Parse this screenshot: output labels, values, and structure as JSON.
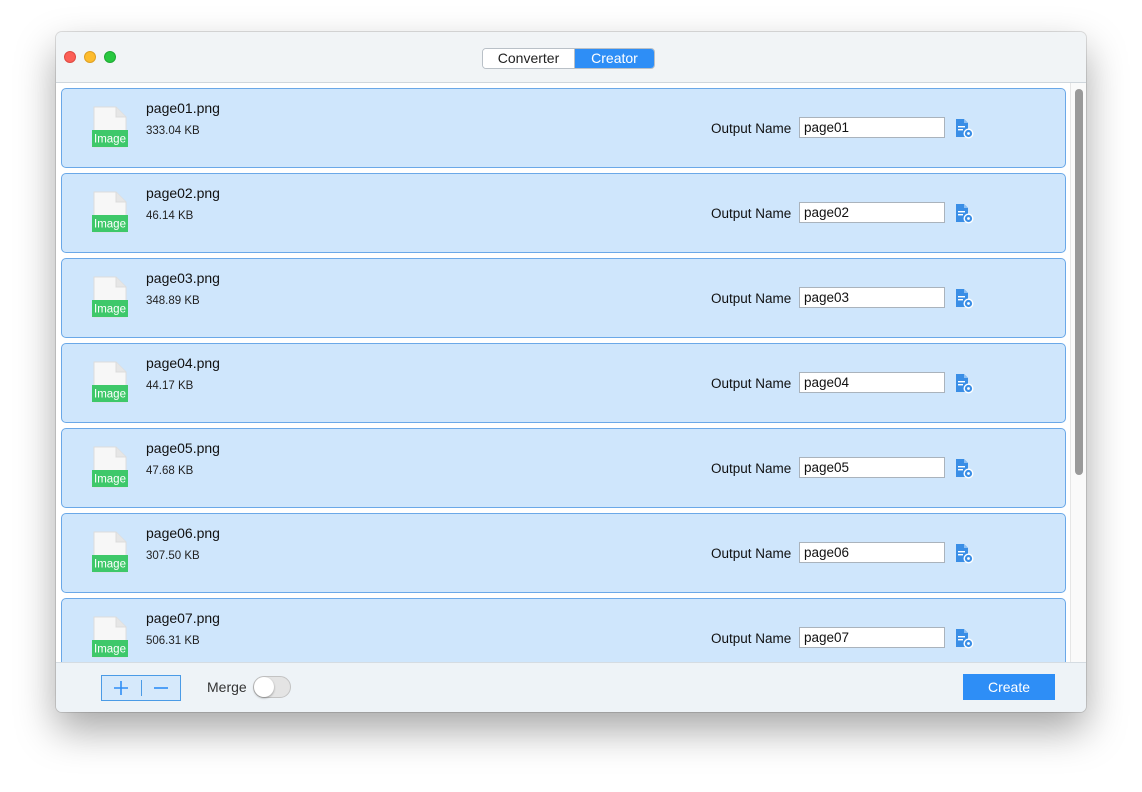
{
  "window": {
    "tabs": [
      {
        "label": "Converter",
        "selected": false
      },
      {
        "label": "Creator",
        "selected": true
      }
    ]
  },
  "files": [
    {
      "type_badge": "Image",
      "name": "page01.png",
      "size": "333.04 KB",
      "output_label": "Output Name",
      "output_name": "page01"
    },
    {
      "type_badge": "Image",
      "name": "page02.png",
      "size": "46.14 KB",
      "output_label": "Output Name",
      "output_name": "page02"
    },
    {
      "type_badge": "Image",
      "name": "page03.png",
      "size": "348.89 KB",
      "output_label": "Output Name",
      "output_name": "page03"
    },
    {
      "type_badge": "Image",
      "name": "page04.png",
      "size": "44.17 KB",
      "output_label": "Output Name",
      "output_name": "page04"
    },
    {
      "type_badge": "Image",
      "name": "page05.png",
      "size": "47.68 KB",
      "output_label": "Output Name",
      "output_name": "page05"
    },
    {
      "type_badge": "Image",
      "name": "page06.png",
      "size": "307.50 KB",
      "output_label": "Output Name",
      "output_name": "page06"
    },
    {
      "type_badge": "Image",
      "name": "page07.png",
      "size": "506.31 KB",
      "output_label": "Output Name",
      "output_name": "page07"
    }
  ],
  "bottom": {
    "merge_label": "Merge",
    "merge_on": false,
    "create_label": "Create"
  },
  "colors": {
    "accent": "#2e8ef6",
    "row_bg": "#cfe6fc",
    "row_border": "#6aa8e8",
    "image_badge": "#3ec86a"
  }
}
